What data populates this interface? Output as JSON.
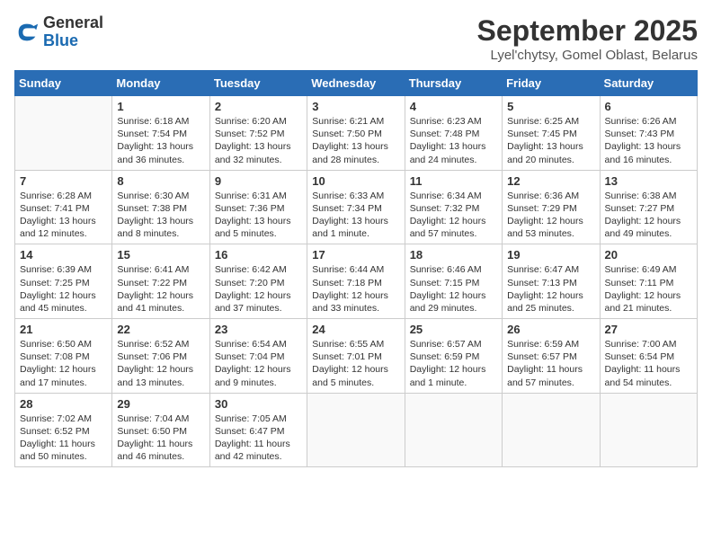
{
  "header": {
    "logo_general": "General",
    "logo_blue": "Blue",
    "month_title": "September 2025",
    "location": "Lyel'chytsy, Gomel Oblast, Belarus"
  },
  "days_of_week": [
    "Sunday",
    "Monday",
    "Tuesday",
    "Wednesday",
    "Thursday",
    "Friday",
    "Saturday"
  ],
  "weeks": [
    [
      {
        "day": "",
        "info": ""
      },
      {
        "day": "1",
        "info": "Sunrise: 6:18 AM\nSunset: 7:54 PM\nDaylight: 13 hours\nand 36 minutes."
      },
      {
        "day": "2",
        "info": "Sunrise: 6:20 AM\nSunset: 7:52 PM\nDaylight: 13 hours\nand 32 minutes."
      },
      {
        "day": "3",
        "info": "Sunrise: 6:21 AM\nSunset: 7:50 PM\nDaylight: 13 hours\nand 28 minutes."
      },
      {
        "day": "4",
        "info": "Sunrise: 6:23 AM\nSunset: 7:48 PM\nDaylight: 13 hours\nand 24 minutes."
      },
      {
        "day": "5",
        "info": "Sunrise: 6:25 AM\nSunset: 7:45 PM\nDaylight: 13 hours\nand 20 minutes."
      },
      {
        "day": "6",
        "info": "Sunrise: 6:26 AM\nSunset: 7:43 PM\nDaylight: 13 hours\nand 16 minutes."
      }
    ],
    [
      {
        "day": "7",
        "info": "Sunrise: 6:28 AM\nSunset: 7:41 PM\nDaylight: 13 hours\nand 12 minutes."
      },
      {
        "day": "8",
        "info": "Sunrise: 6:30 AM\nSunset: 7:38 PM\nDaylight: 13 hours\nand 8 minutes."
      },
      {
        "day": "9",
        "info": "Sunrise: 6:31 AM\nSunset: 7:36 PM\nDaylight: 13 hours\nand 5 minutes."
      },
      {
        "day": "10",
        "info": "Sunrise: 6:33 AM\nSunset: 7:34 PM\nDaylight: 13 hours\nand 1 minute."
      },
      {
        "day": "11",
        "info": "Sunrise: 6:34 AM\nSunset: 7:32 PM\nDaylight: 12 hours\nand 57 minutes."
      },
      {
        "day": "12",
        "info": "Sunrise: 6:36 AM\nSunset: 7:29 PM\nDaylight: 12 hours\nand 53 minutes."
      },
      {
        "day": "13",
        "info": "Sunrise: 6:38 AM\nSunset: 7:27 PM\nDaylight: 12 hours\nand 49 minutes."
      }
    ],
    [
      {
        "day": "14",
        "info": "Sunrise: 6:39 AM\nSunset: 7:25 PM\nDaylight: 12 hours\nand 45 minutes."
      },
      {
        "day": "15",
        "info": "Sunrise: 6:41 AM\nSunset: 7:22 PM\nDaylight: 12 hours\nand 41 minutes."
      },
      {
        "day": "16",
        "info": "Sunrise: 6:42 AM\nSunset: 7:20 PM\nDaylight: 12 hours\nand 37 minutes."
      },
      {
        "day": "17",
        "info": "Sunrise: 6:44 AM\nSunset: 7:18 PM\nDaylight: 12 hours\nand 33 minutes."
      },
      {
        "day": "18",
        "info": "Sunrise: 6:46 AM\nSunset: 7:15 PM\nDaylight: 12 hours\nand 29 minutes."
      },
      {
        "day": "19",
        "info": "Sunrise: 6:47 AM\nSunset: 7:13 PM\nDaylight: 12 hours\nand 25 minutes."
      },
      {
        "day": "20",
        "info": "Sunrise: 6:49 AM\nSunset: 7:11 PM\nDaylight: 12 hours\nand 21 minutes."
      }
    ],
    [
      {
        "day": "21",
        "info": "Sunrise: 6:50 AM\nSunset: 7:08 PM\nDaylight: 12 hours\nand 17 minutes."
      },
      {
        "day": "22",
        "info": "Sunrise: 6:52 AM\nSunset: 7:06 PM\nDaylight: 12 hours\nand 13 minutes."
      },
      {
        "day": "23",
        "info": "Sunrise: 6:54 AM\nSunset: 7:04 PM\nDaylight: 12 hours\nand 9 minutes."
      },
      {
        "day": "24",
        "info": "Sunrise: 6:55 AM\nSunset: 7:01 PM\nDaylight: 12 hours\nand 5 minutes."
      },
      {
        "day": "25",
        "info": "Sunrise: 6:57 AM\nSunset: 6:59 PM\nDaylight: 12 hours\nand 1 minute."
      },
      {
        "day": "26",
        "info": "Sunrise: 6:59 AM\nSunset: 6:57 PM\nDaylight: 11 hours\nand 57 minutes."
      },
      {
        "day": "27",
        "info": "Sunrise: 7:00 AM\nSunset: 6:54 PM\nDaylight: 11 hours\nand 54 minutes."
      }
    ],
    [
      {
        "day": "28",
        "info": "Sunrise: 7:02 AM\nSunset: 6:52 PM\nDaylight: 11 hours\nand 50 minutes."
      },
      {
        "day": "29",
        "info": "Sunrise: 7:04 AM\nSunset: 6:50 PM\nDaylight: 11 hours\nand 46 minutes."
      },
      {
        "day": "30",
        "info": "Sunrise: 7:05 AM\nSunset: 6:47 PM\nDaylight: 11 hours\nand 42 minutes."
      },
      {
        "day": "",
        "info": ""
      },
      {
        "day": "",
        "info": ""
      },
      {
        "day": "",
        "info": ""
      },
      {
        "day": "",
        "info": ""
      }
    ]
  ]
}
